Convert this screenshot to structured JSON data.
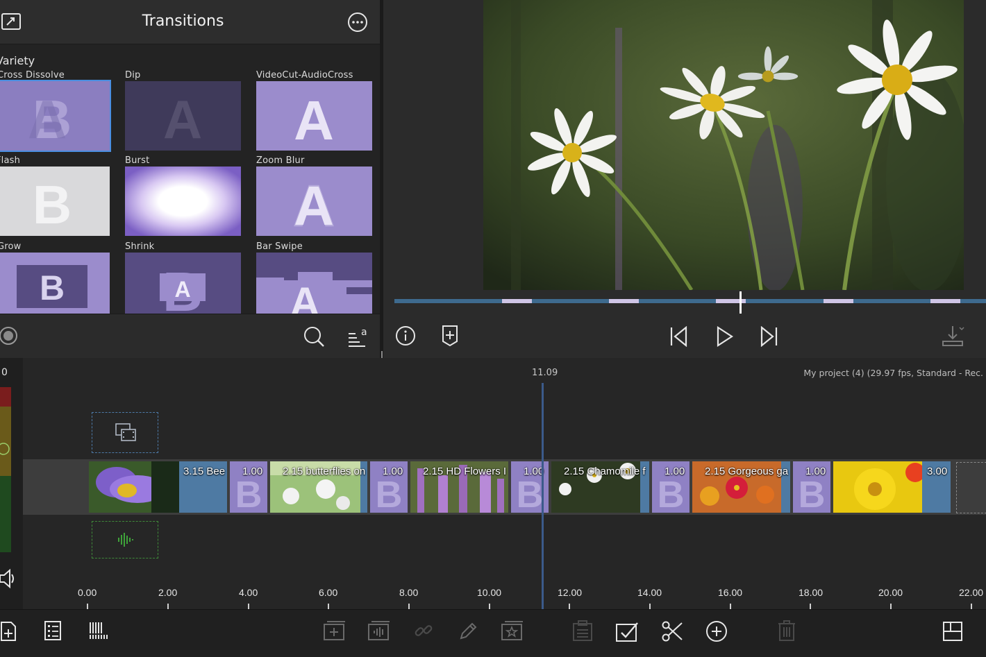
{
  "transitions": {
    "title": "Transitions",
    "category": "Variety",
    "tiles": [
      {
        "label": "Cross Dissolve",
        "glyph": "B"
      },
      {
        "label": "Dip",
        "glyph": "A"
      },
      {
        "label": "VideoCut-AudioCross",
        "glyph": "A"
      },
      {
        "label": "Flash",
        "glyph": "B"
      },
      {
        "label": "Burst",
        "glyph": ""
      },
      {
        "label": "Zoom Blur",
        "glyph": "A"
      },
      {
        "label": "Grow",
        "glyph": "B"
      },
      {
        "label": "Shrink",
        "glyph": "A"
      },
      {
        "label": "Bar Swipe",
        "glyph": "B"
      }
    ]
  },
  "viewer": {
    "controls": [
      "info-icon",
      "add-marker-icon",
      "skip-back-icon",
      "play-icon",
      "skip-forward-icon",
      "export-icon"
    ]
  },
  "timeline": {
    "playhead_time": "11.09",
    "project_info": "My project (4) (29.97 fps, Standard - Rec.",
    "level_label": "0",
    "clips": [
      {
        "label": "3.15 Bee",
        "kind": "video"
      },
      {
        "label": "1.00",
        "kind": "transition"
      },
      {
        "label": "2.15 butterflies on",
        "kind": "video"
      },
      {
        "label": "1.00",
        "kind": "transition"
      },
      {
        "label": "2.15 HD Flowers I",
        "kind": "video"
      },
      {
        "label": "1.00",
        "kind": "transition"
      },
      {
        "label": "2.15 Chamomile f",
        "kind": "video"
      },
      {
        "label": "1.00",
        "kind": "transition"
      },
      {
        "label": "2.15 Gorgeous ga",
        "kind": "video"
      },
      {
        "label": "1.00",
        "kind": "transition"
      },
      {
        "label": "3.00",
        "kind": "video"
      }
    ],
    "ruler": [
      "0.00",
      "2.00",
      "4.00",
      "6.00",
      "8.00",
      "10.00",
      "12.00",
      "14.00",
      "16.00",
      "18.00",
      "20.00",
      "22.00"
    ]
  },
  "colors": {
    "accent": "#4a8ee0",
    "transition_tile": "#9b8ccc",
    "clip_blue": "#4e7aa3"
  }
}
